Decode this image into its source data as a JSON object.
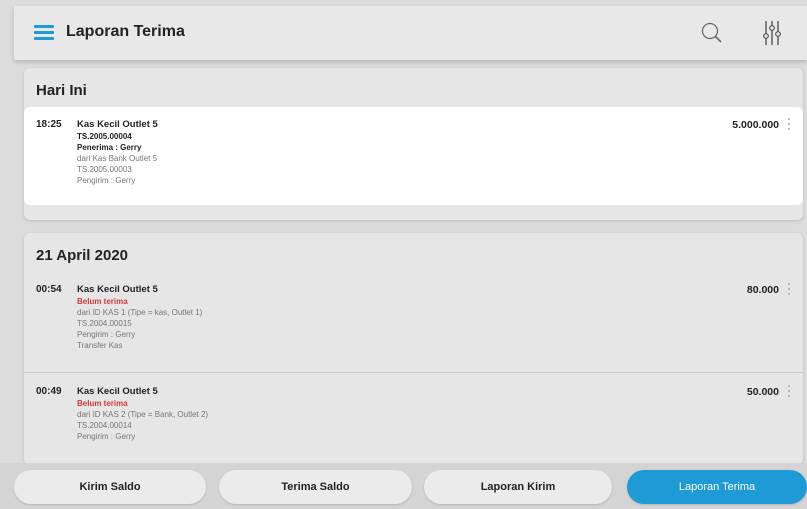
{
  "header": {
    "title": "Laporan Terima"
  },
  "icons": {
    "menu": "menu-icon",
    "search": "search-icon",
    "filter": "filter-icon",
    "more": "more-vert-icon"
  },
  "colors": {
    "accent": "#1e9bd7",
    "status_red": "#d23a3a"
  },
  "sections": [
    {
      "title": "Hari Ini",
      "entries": [
        {
          "time": "18:25",
          "name": "Kas Kecil Outlet 5",
          "lines": [
            "TS.2005.00004",
            "Penerima : Gerry",
            "dari Kas Bank Outlet 5",
            "TS.2005.00003",
            "Pengirim : Gerry"
          ],
          "amount": "5.000.000"
        }
      ]
    },
    {
      "title": "21 April 2020",
      "entries": [
        {
          "time": "00:54",
          "name": "Kas Kecil Outlet 5",
          "status": "Belum terima",
          "lines": [
            "dari ID KAS 1 (Tipe = kas, Outlet 1)",
            "TS.2004.00015",
            "Pengirim : Gerry",
            "Transfer Kas"
          ],
          "amount": "80.000"
        },
        {
          "time": "00:49",
          "name": "Kas Kecil Outlet 5",
          "status": "Belum terima",
          "lines": [
            "dari ID KAS 2 (Tipe = Bank, Outlet 2)",
            "TS.2004.00014",
            "Pengirim : Gerry"
          ],
          "amount": "50.000"
        }
      ]
    }
  ],
  "bottom_tabs": [
    {
      "label": "Kirim Saldo",
      "active": false
    },
    {
      "label": "Terima Saldo",
      "active": false
    },
    {
      "label": "Laporan Kirim",
      "active": false
    },
    {
      "label": "Laporan Terima",
      "active": true
    }
  ]
}
